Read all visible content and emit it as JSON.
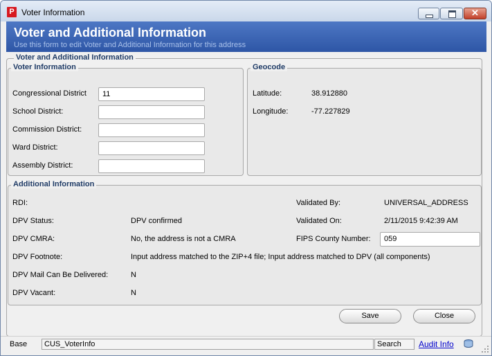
{
  "window": {
    "title": "Voter Information",
    "app_icon_letter": "P"
  },
  "header": {
    "title": "Voter and Additional Information",
    "subtitle": "Use this form to edit Voter and Additional Information for this address"
  },
  "main_group": {
    "legend": "Voter and Additional Information"
  },
  "voter": {
    "legend": "Voter Information",
    "fields": [
      {
        "label": "Congressional District",
        "value": "11"
      },
      {
        "label": "School District:",
        "value": ""
      },
      {
        "label": "Commission District:",
        "value": ""
      },
      {
        "label": "Ward District:",
        "value": ""
      },
      {
        "label": "Assembly District:",
        "value": ""
      }
    ]
  },
  "geocode": {
    "legend": "Geocode",
    "latitude_label": "Latitude:",
    "latitude": "38.912880",
    "longitude_label": "Longitude:",
    "longitude": "-77.227829"
  },
  "additional": {
    "legend": "Additional Information",
    "rdi_label": "RDI:",
    "rdi": "",
    "dpv_status_label": "DPV Status:",
    "dpv_status": "DPV confirmed",
    "dpv_cmra_label": "DPV CMRA:",
    "dpv_cmra": "No, the address is not a CMRA",
    "dpv_footnote_label": "DPV Footnote:",
    "dpv_footnote": "Input address matched to the ZIP+4 file; Input address matched to DPV (all components)",
    "dpv_mail_label": "DPV Mail Can Be Delivered:",
    "dpv_mail": "N",
    "dpv_vacant_label": "DPV Vacant:",
    "dpv_vacant": "N",
    "validated_by_label": "Validated By:",
    "validated_by": "UNIVERSAL_ADDRESS",
    "validated_on_label": "Validated On:",
    "validated_on": "2/11/2015 9:42:39 AM",
    "fips_label": "FIPS County Number:",
    "fips": "059"
  },
  "buttons": {
    "save": "Save",
    "close": "Close"
  },
  "statusbar": {
    "base": "Base",
    "form_name": "CUS_VoterInfo",
    "search": "Search",
    "audit": "Audit Info"
  }
}
